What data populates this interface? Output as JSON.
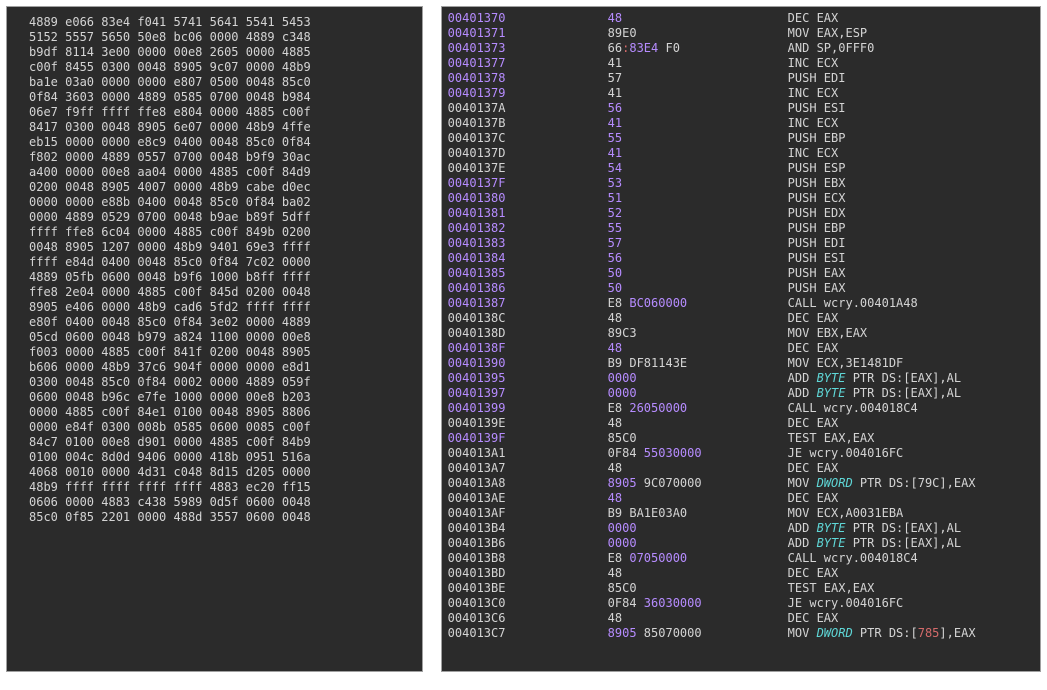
{
  "hex": {
    "rows": [
      "4889 e066 83e4 f041 5741 5641 5541 5453",
      "5152 5557 5650 50e8 bc06 0000 4889 c348",
      "b9df 8114 3e00 0000 00e8 2605 0000 4885",
      "c00f 8455 0300 0048 8905 9c07 0000 48b9",
      "ba1e 03a0 0000 0000 e807 0500 0048 85c0",
      "0f84 3603 0000 4889 0585 0700 0048 b984",
      "06e7 f9ff ffff ffe8 e804 0000 4885 c00f",
      "8417 0300 0048 8905 6e07 0000 48b9 4ffe",
      "eb15 0000 0000 e8c9 0400 0048 85c0 0f84",
      "f802 0000 4889 0557 0700 0048 b9f9 30ac",
      "a400 0000 00e8 aa04 0000 4885 c00f 84d9",
      "0200 0048 8905 4007 0000 48b9 cabe d0ec",
      "0000 0000 e88b 0400 0048 85c0 0f84 ba02",
      "0000 4889 0529 0700 0048 b9ae b89f 5dff",
      "ffff ffe8 6c04 0000 4885 c00f 849b 0200",
      "0048 8905 1207 0000 48b9 9401 69e3 ffff",
      "ffff e84d 0400 0048 85c0 0f84 7c02 0000",
      "4889 05fb 0600 0048 b9f6 1000 b8ff ffff",
      "ffe8 2e04 0000 4885 c00f 845d 0200 0048",
      "8905 e406 0000 48b9 cad6 5fd2 ffff ffff",
      "e80f 0400 0048 85c0 0f84 3e02 0000 4889",
      "05cd 0600 0048 b979 a824 1100 0000 00e8",
      "f003 0000 4885 c00f 841f 0200 0048 8905",
      "b606 0000 48b9 37c6 904f 0000 0000 e8d1",
      "0300 0048 85c0 0f84 0002 0000 4889 059f",
      "0600 0048 b96c e7fe 1000 0000 00e8 b203",
      "0000 4885 c00f 84e1 0100 0048 8905 8806",
      "0000 e84f 0300 008b 0585 0600 0085 c00f",
      "84c7 0100 00e8 d901 0000 4885 c00f 84b9",
      "0100 004c 8d0d 9406 0000 418b 0951 516a",
      "4068 0010 0000 4d31 c048 8d15 d205 0000",
      "48b9 ffff ffff ffff ffff 4883 ec20 ff15",
      "0606 0000 4883 c438 5989 0d5f 0600 0048",
      "85c0 0f85 2201 0000 488d 3557 0600 0048"
    ]
  },
  "disasm": {
    "rows": [
      {
        "a": "00401370",
        "aC": "purp",
        "b": [
          [
            "48",
            "purp"
          ]
        ],
        "i": "DEC EAX"
      },
      {
        "a": "00401371",
        "aC": "purp",
        "b": [
          [
            "89E0",
            "gray"
          ]
        ],
        "i": "MOV EAX,ESP"
      },
      {
        "a": "00401373",
        "aC": "purp",
        "b": [
          [
            "66",
            "gray"
          ],
          [
            ":",
            "red"
          ],
          [
            "83E4",
            "purp"
          ],
          [
            " F0",
            "gray"
          ]
        ],
        "i": "AND SP,0FFF0"
      },
      {
        "a": "00401377",
        "aC": "purp",
        "b": [
          [
            "41",
            "gray"
          ]
        ],
        "i": "INC ECX"
      },
      {
        "a": "00401378",
        "aC": "purp",
        "b": [
          [
            "57",
            "gray"
          ]
        ],
        "i": "PUSH EDI"
      },
      {
        "a": "00401379",
        "aC": "purp",
        "b": [
          [
            "41",
            "gray"
          ]
        ],
        "i": "INC ECX"
      },
      {
        "a": "0040137A",
        "aC": "gray",
        "b": [
          [
            "56",
            "purp"
          ]
        ],
        "i": "PUSH ESI"
      },
      {
        "a": "0040137B",
        "aC": "gray",
        "b": [
          [
            "41",
            "purp"
          ]
        ],
        "i": "INC ECX"
      },
      {
        "a": "0040137C",
        "aC": "gray",
        "b": [
          [
            "55",
            "purp"
          ]
        ],
        "i": "PUSH EBP"
      },
      {
        "a": "0040137D",
        "aC": "gray",
        "b": [
          [
            "41",
            "purp"
          ]
        ],
        "i": "INC ECX"
      },
      {
        "a": "0040137E",
        "aC": "gray",
        "b": [
          [
            "54",
            "purp"
          ]
        ],
        "i": "PUSH ESP"
      },
      {
        "a": "0040137F",
        "aC": "purp",
        "b": [
          [
            "53",
            "purp"
          ]
        ],
        "i": "PUSH EBX"
      },
      {
        "a": "00401380",
        "aC": "purp",
        "b": [
          [
            "51",
            "purp"
          ]
        ],
        "i": "PUSH ECX"
      },
      {
        "a": "00401381",
        "aC": "purp",
        "b": [
          [
            "52",
            "purp"
          ]
        ],
        "i": "PUSH EDX"
      },
      {
        "a": "00401382",
        "aC": "purp",
        "b": [
          [
            "55",
            "purp"
          ]
        ],
        "i": "PUSH EBP"
      },
      {
        "a": "00401383",
        "aC": "purp",
        "b": [
          [
            "57",
            "purp"
          ]
        ],
        "i": "PUSH EDI"
      },
      {
        "a": "00401384",
        "aC": "purp",
        "b": [
          [
            "56",
            "purp"
          ]
        ],
        "i": "PUSH ESI"
      },
      {
        "a": "00401385",
        "aC": "purp",
        "b": [
          [
            "50",
            "purp"
          ]
        ],
        "i": "PUSH EAX"
      },
      {
        "a": "00401386",
        "aC": "purp",
        "b": [
          [
            "50",
            "purp"
          ]
        ],
        "i": "PUSH EAX"
      },
      {
        "a": "00401387",
        "aC": "purp",
        "b": [
          [
            "E8 ",
            "gray"
          ],
          [
            "BC060000",
            "purp"
          ]
        ],
        "i": "CALL wcry.00401A48"
      },
      {
        "a": "0040138C",
        "aC": "gray",
        "b": [
          [
            "48",
            "gray"
          ]
        ],
        "i": "DEC EAX"
      },
      {
        "a": "0040138D",
        "aC": "gray",
        "b": [
          [
            "89C3",
            "gray"
          ]
        ],
        "i": "MOV EBX,EAX"
      },
      {
        "a": "0040138F",
        "aC": "purp",
        "b": [
          [
            "48",
            "purp"
          ]
        ],
        "i": "DEC EAX"
      },
      {
        "a": "00401390",
        "aC": "purp",
        "b": [
          [
            "B9 DF81143E",
            "gray"
          ]
        ],
        "i": "MOV ECX,3E1481DF"
      },
      {
        "a": "00401395",
        "aC": "purp",
        "b": [
          [
            "0000",
            "purp"
          ]
        ],
        "ih": "ADD <i class='cyan'>BYTE</i> PTR DS:[EAX],AL"
      },
      {
        "a": "00401397",
        "aC": "purp",
        "b": [
          [
            "0000",
            "purp"
          ]
        ],
        "ih": "ADD <i class='cyan'>BYTE</i> PTR DS:[EAX],AL"
      },
      {
        "a": "00401399",
        "aC": "purp",
        "b": [
          [
            "E8 ",
            "gray"
          ],
          [
            "26050000",
            "purp"
          ]
        ],
        "i": "CALL wcry.004018C4"
      },
      {
        "a": "0040139E",
        "aC": "gray",
        "b": [
          [
            "48",
            "gray"
          ]
        ],
        "i": "DEC EAX"
      },
      {
        "a": "0040139F",
        "aC": "purp",
        "b": [
          [
            "85C0",
            "gray"
          ]
        ],
        "i": "TEST EAX,EAX"
      },
      {
        "a": "004013A1",
        "aC": "gray",
        "b": [
          [
            "0F84 ",
            "gray"
          ],
          [
            "55030000",
            "purp"
          ]
        ],
        "i": "JE wcry.004016FC"
      },
      {
        "a": "004013A7",
        "aC": "gray",
        "b": [
          [
            "48",
            "gray"
          ]
        ],
        "i": "DEC EAX"
      },
      {
        "a": "004013A8",
        "aC": "gray",
        "b": [
          [
            "8905",
            "purp"
          ],
          [
            " 9C070000",
            "gray"
          ]
        ],
        "ih": "MOV <i class='cyan'>DWORD</i> PTR DS:[79C],EAX"
      },
      {
        "a": "004013AE",
        "aC": "gray",
        "b": [
          [
            "48",
            "purp"
          ]
        ],
        "i": "DEC EAX"
      },
      {
        "a": "004013AF",
        "aC": "gray",
        "b": [
          [
            "B9 BA1E03A0",
            "gray"
          ]
        ],
        "i": "MOV ECX,A0031EBA"
      },
      {
        "a": "004013B4",
        "aC": "gray",
        "b": [
          [
            "0000",
            "purp"
          ]
        ],
        "ih": "ADD <i class='cyan'>BYTE</i> PTR DS:[EAX],AL"
      },
      {
        "a": "004013B6",
        "aC": "gray",
        "b": [
          [
            "0000",
            "purp"
          ]
        ],
        "ih": "ADD <i class='cyan'>BYTE</i> PTR DS:[EAX],AL"
      },
      {
        "a": "004013B8",
        "aC": "gray",
        "b": [
          [
            "E8 ",
            "gray"
          ],
          [
            "07050000",
            "purp"
          ]
        ],
        "i": "CALL wcry.004018C4"
      },
      {
        "a": "004013BD",
        "aC": "gray",
        "b": [
          [
            "48",
            "gray"
          ]
        ],
        "i": "DEC EAX"
      },
      {
        "a": "004013BE",
        "aC": "gray",
        "b": [
          [
            "85C0",
            "gray"
          ]
        ],
        "i": "TEST EAX,EAX"
      },
      {
        "a": "004013C0",
        "aC": "gray",
        "b": [
          [
            "0F84 ",
            "gray"
          ],
          [
            "36030000",
            "purp"
          ]
        ],
        "i": "JE wcry.004016FC"
      },
      {
        "a": "004013C6",
        "aC": "gray",
        "b": [
          [
            "48",
            "gray"
          ]
        ],
        "i": "DEC EAX"
      },
      {
        "a": "004013C7",
        "aC": "gray",
        "b": [
          [
            "8905",
            "purp"
          ],
          [
            " 85070000",
            "gray"
          ]
        ],
        "ih": "MOV <i class='cyan'>DWORD</i> PTR DS:[<span class='red'>785</span>],EAX"
      }
    ]
  }
}
